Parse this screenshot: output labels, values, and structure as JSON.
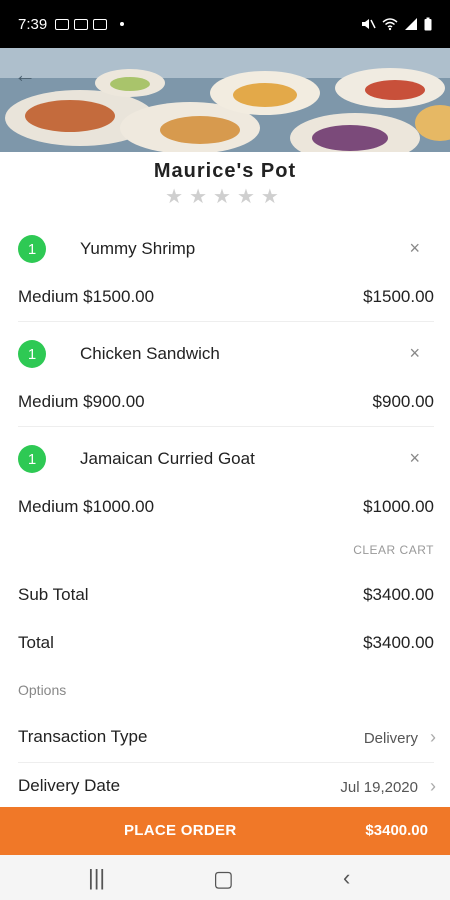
{
  "status_bar": {
    "time": "7:39"
  },
  "restaurant": {
    "name": "Maurice's Pot",
    "rating_stars": 5,
    "rating_filled": 0
  },
  "cart": {
    "items": [
      {
        "qty": "1",
        "name": "Yummy Shrimp",
        "size": "Medium $1500.00",
        "price": "$1500.00",
        "remove": "×"
      },
      {
        "qty": "1",
        "name": "Chicken Sandwich",
        "size": "Medium $900.00",
        "price": "$900.00",
        "remove": "×"
      },
      {
        "qty": "1",
        "name": "Jamaican Curried Goat",
        "size": "Medium $1000.00",
        "price": "$1000.00",
        "remove": "×"
      }
    ],
    "clear_label": "CLEAR CART"
  },
  "summary": {
    "subtotal_label": "Sub Total",
    "subtotal_value": "$3400.00",
    "total_label": "Total",
    "total_value": "$3400.00"
  },
  "options": {
    "section_label": "Options",
    "transaction_label": "Transaction Type",
    "transaction_value": "Delivery",
    "date_label": "Delivery Date",
    "date_value": "Jul 19,2020"
  },
  "order_button": {
    "label": "PLACE ORDER",
    "total": "$3400.00"
  },
  "colors": {
    "accent": "#f07828",
    "badge": "#2ec954"
  },
  "icons": [
    "back-arrow-icon",
    "close-icon",
    "star-icon",
    "chevron-right-icon"
  ]
}
